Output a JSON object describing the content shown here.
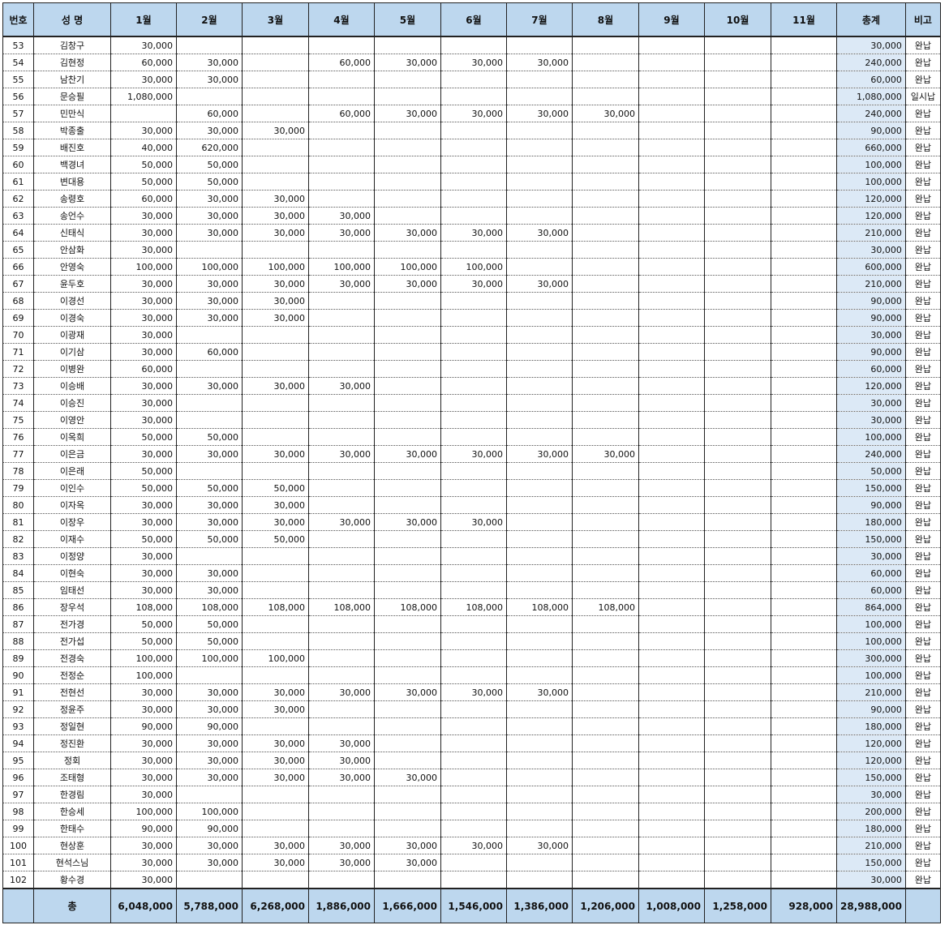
{
  "headers": {
    "no": "번호",
    "name": "성 명",
    "months": [
      "1월",
      "2월",
      "3월",
      "4월",
      "5월",
      "6월",
      "7월",
      "8월",
      "9월",
      "10월",
      "11월"
    ],
    "total": "총계",
    "note": "비고"
  },
  "rows": [
    {
      "no": "53",
      "name": "김창구",
      "m": [
        "30,000",
        "",
        "",
        "",
        "",
        "",
        "",
        "",
        "",
        "",
        ""
      ],
      "total": "30,000",
      "note": "완납"
    },
    {
      "no": "54",
      "name": "김현정",
      "m": [
        "60,000",
        "30,000",
        "",
        "60,000",
        "30,000",
        "30,000",
        "30,000",
        "",
        "",
        "",
        ""
      ],
      "total": "240,000",
      "note": "완납"
    },
    {
      "no": "55",
      "name": "남찬기",
      "m": [
        "30,000",
        "30,000",
        "",
        "",
        "",
        "",
        "",
        "",
        "",
        "",
        ""
      ],
      "total": "60,000",
      "note": "완납"
    },
    {
      "no": "56",
      "name": "문승필",
      "m": [
        "1,080,000",
        "",
        "",
        "",
        "",
        "",
        "",
        "",
        "",
        "",
        ""
      ],
      "total": "1,080,000",
      "note": "일시납"
    },
    {
      "no": "57",
      "name": "민만식",
      "m": [
        "",
        "60,000",
        "",
        "60,000",
        "30,000",
        "30,000",
        "30,000",
        "30,000",
        "",
        "",
        ""
      ],
      "total": "240,000",
      "note": "완납"
    },
    {
      "no": "58",
      "name": "박종출",
      "m": [
        "30,000",
        "30,000",
        "30,000",
        "",
        "",
        "",
        "",
        "",
        "",
        "",
        ""
      ],
      "total": "90,000",
      "note": "완납"
    },
    {
      "no": "59",
      "name": "배진호",
      "m": [
        "40,000",
        "620,000",
        "",
        "",
        "",
        "",
        "",
        "",
        "",
        "",
        ""
      ],
      "total": "660,000",
      "note": "완납"
    },
    {
      "no": "60",
      "name": "백경녀",
      "m": [
        "50,000",
        "50,000",
        "",
        "",
        "",
        "",
        "",
        "",
        "",
        "",
        ""
      ],
      "total": "100,000",
      "note": "완납"
    },
    {
      "no": "61",
      "name": "변대용",
      "m": [
        "50,000",
        "50,000",
        "",
        "",
        "",
        "",
        "",
        "",
        "",
        "",
        ""
      ],
      "total": "100,000",
      "note": "완납"
    },
    {
      "no": "62",
      "name": "송령호",
      "m": [
        "60,000",
        "30,000",
        "30,000",
        "",
        "",
        "",
        "",
        "",
        "",
        "",
        ""
      ],
      "total": "120,000",
      "note": "완납"
    },
    {
      "no": "63",
      "name": "송언수",
      "m": [
        "30,000",
        "30,000",
        "30,000",
        "30,000",
        "",
        "",
        "",
        "",
        "",
        "",
        ""
      ],
      "total": "120,000",
      "note": "완납"
    },
    {
      "no": "64",
      "name": "신태식",
      "m": [
        "30,000",
        "30,000",
        "30,000",
        "30,000",
        "30,000",
        "30,000",
        "30,000",
        "",
        "",
        "",
        ""
      ],
      "total": "210,000",
      "note": "완납"
    },
    {
      "no": "65",
      "name": "안삼화",
      "m": [
        "30,000",
        "",
        "",
        "",
        "",
        "",
        "",
        "",
        "",
        "",
        ""
      ],
      "total": "30,000",
      "note": "완납"
    },
    {
      "no": "66",
      "name": "안영숙",
      "m": [
        "100,000",
        "100,000",
        "100,000",
        "100,000",
        "100,000",
        "100,000",
        "",
        "",
        "",
        "",
        ""
      ],
      "total": "600,000",
      "note": "완납"
    },
    {
      "no": "67",
      "name": "윤두호",
      "m": [
        "30,000",
        "30,000",
        "30,000",
        "30,000",
        "30,000",
        "30,000",
        "30,000",
        "",
        "",
        "",
        ""
      ],
      "total": "210,000",
      "note": "완납"
    },
    {
      "no": "68",
      "name": "이경선",
      "m": [
        "30,000",
        "30,000",
        "30,000",
        "",
        "",
        "",
        "",
        "",
        "",
        "",
        ""
      ],
      "total": "90,000",
      "note": "완납"
    },
    {
      "no": "69",
      "name": "이경숙",
      "m": [
        "30,000",
        "30,000",
        "30,000",
        "",
        "",
        "",
        "",
        "",
        "",
        "",
        ""
      ],
      "total": "90,000",
      "note": "완납"
    },
    {
      "no": "70",
      "name": "이광재",
      "m": [
        "30,000",
        "",
        "",
        "",
        "",
        "",
        "",
        "",
        "",
        "",
        ""
      ],
      "total": "30,000",
      "note": "완납"
    },
    {
      "no": "71",
      "name": "이기삼",
      "m": [
        "30,000",
        "60,000",
        "",
        "",
        "",
        "",
        "",
        "",
        "",
        "",
        ""
      ],
      "total": "90,000",
      "note": "완납"
    },
    {
      "no": "72",
      "name": "이병완",
      "m": [
        "60,000",
        "",
        "",
        "",
        "",
        "",
        "",
        "",
        "",
        "",
        ""
      ],
      "total": "60,000",
      "note": "완납"
    },
    {
      "no": "73",
      "name": "이승배",
      "m": [
        "30,000",
        "30,000",
        "30,000",
        "30,000",
        "",
        "",
        "",
        "",
        "",
        "",
        ""
      ],
      "total": "120,000",
      "note": "완납"
    },
    {
      "no": "74",
      "name": "이승진",
      "m": [
        "30,000",
        "",
        "",
        "",
        "",
        "",
        "",
        "",
        "",
        "",
        ""
      ],
      "total": "30,000",
      "note": "완납"
    },
    {
      "no": "75",
      "name": "이영안",
      "m": [
        "30,000",
        "",
        "",
        "",
        "",
        "",
        "",
        "",
        "",
        "",
        ""
      ],
      "total": "30,000",
      "note": "완납"
    },
    {
      "no": "76",
      "name": "이옥희",
      "m": [
        "50,000",
        "50,000",
        "",
        "",
        "",
        "",
        "",
        "",
        "",
        "",
        ""
      ],
      "total": "100,000",
      "note": "완납"
    },
    {
      "no": "77",
      "name": "이은금",
      "m": [
        "30,000",
        "30,000",
        "30,000",
        "30,000",
        "30,000",
        "30,000",
        "30,000",
        "30,000",
        "",
        "",
        ""
      ],
      "total": "240,000",
      "note": "완납"
    },
    {
      "no": "78",
      "name": "이은래",
      "m": [
        "50,000",
        "",
        "",
        "",
        "",
        "",
        "",
        "",
        "",
        "",
        ""
      ],
      "total": "50,000",
      "note": "완납"
    },
    {
      "no": "79",
      "name": "이인수",
      "m": [
        "50,000",
        "50,000",
        "50,000",
        "",
        "",
        "",
        "",
        "",
        "",
        "",
        ""
      ],
      "total": "150,000",
      "note": "완납"
    },
    {
      "no": "80",
      "name": "이자옥",
      "m": [
        "30,000",
        "30,000",
        "30,000",
        "",
        "",
        "",
        "",
        "",
        "",
        "",
        ""
      ],
      "total": "90,000",
      "note": "완납"
    },
    {
      "no": "81",
      "name": "이장우",
      "m": [
        "30,000",
        "30,000",
        "30,000",
        "30,000",
        "30,000",
        "30,000",
        "",
        "",
        "",
        "",
        ""
      ],
      "total": "180,000",
      "note": "완납"
    },
    {
      "no": "82",
      "name": "이재수",
      "m": [
        "50,000",
        "50,000",
        "50,000",
        "",
        "",
        "",
        "",
        "",
        "",
        "",
        ""
      ],
      "total": "150,000",
      "note": "완납"
    },
    {
      "no": "83",
      "name": "이정양",
      "m": [
        "30,000",
        "",
        "",
        "",
        "",
        "",
        "",
        "",
        "",
        "",
        ""
      ],
      "total": "30,000",
      "note": "완납"
    },
    {
      "no": "84",
      "name": "이현숙",
      "m": [
        "30,000",
        "30,000",
        "",
        "",
        "",
        "",
        "",
        "",
        "",
        "",
        ""
      ],
      "total": "60,000",
      "note": "완납"
    },
    {
      "no": "85",
      "name": "임태선",
      "m": [
        "30,000",
        "30,000",
        "",
        "",
        "",
        "",
        "",
        "",
        "",
        "",
        ""
      ],
      "total": "60,000",
      "note": "완납"
    },
    {
      "no": "86",
      "name": "장우석",
      "m": [
        "108,000",
        "108,000",
        "108,000",
        "108,000",
        "108,000",
        "108,000",
        "108,000",
        "108,000",
        "",
        "",
        ""
      ],
      "total": "864,000",
      "note": "완납"
    },
    {
      "no": "87",
      "name": "전가경",
      "m": [
        "50,000",
        "50,000",
        "",
        "",
        "",
        "",
        "",
        "",
        "",
        "",
        ""
      ],
      "total": "100,000",
      "note": "완납"
    },
    {
      "no": "88",
      "name": "전가섭",
      "m": [
        "50,000",
        "50,000",
        "",
        "",
        "",
        "",
        "",
        "",
        "",
        "",
        ""
      ],
      "total": "100,000",
      "note": "완납"
    },
    {
      "no": "89",
      "name": "전경숙",
      "m": [
        "100,000",
        "100,000",
        "100,000",
        "",
        "",
        "",
        "",
        "",
        "",
        "",
        ""
      ],
      "total": "300,000",
      "note": "완납"
    },
    {
      "no": "90",
      "name": "전정순",
      "m": [
        "100,000",
        "",
        "",
        "",
        "",
        "",
        "",
        "",
        "",
        "",
        ""
      ],
      "total": "100,000",
      "note": "완납"
    },
    {
      "no": "91",
      "name": "전현선",
      "m": [
        "30,000",
        "30,000",
        "30,000",
        "30,000",
        "30,000",
        "30,000",
        "30,000",
        "",
        "",
        "",
        ""
      ],
      "total": "210,000",
      "note": "완납"
    },
    {
      "no": "92",
      "name": "정윤주",
      "m": [
        "30,000",
        "30,000",
        "30,000",
        "",
        "",
        "",
        "",
        "",
        "",
        "",
        ""
      ],
      "total": "90,000",
      "note": "완납"
    },
    {
      "no": "93",
      "name": "정일현",
      "m": [
        "90,000",
        "90,000",
        "",
        "",
        "",
        "",
        "",
        "",
        "",
        "",
        ""
      ],
      "total": "180,000",
      "note": "완납"
    },
    {
      "no": "94",
      "name": "정진환",
      "m": [
        "30,000",
        "30,000",
        "30,000",
        "30,000",
        "",
        "",
        "",
        "",
        "",
        "",
        ""
      ],
      "total": "120,000",
      "note": "완납"
    },
    {
      "no": "95",
      "name": "정회",
      "m": [
        "30,000",
        "30,000",
        "30,000",
        "30,000",
        "",
        "",
        "",
        "",
        "",
        "",
        ""
      ],
      "total": "120,000",
      "note": "완납"
    },
    {
      "no": "96",
      "name": "조태형",
      "m": [
        "30,000",
        "30,000",
        "30,000",
        "30,000",
        "30,000",
        "",
        "",
        "",
        "",
        "",
        ""
      ],
      "total": "150,000",
      "note": "완납"
    },
    {
      "no": "97",
      "name": "한경림",
      "m": [
        "30,000",
        "",
        "",
        "",
        "",
        "",
        "",
        "",
        "",
        "",
        ""
      ],
      "total": "30,000",
      "note": "완납"
    },
    {
      "no": "98",
      "name": "한승세",
      "m": [
        "100,000",
        "100,000",
        "",
        "",
        "",
        "",
        "",
        "",
        "",
        "",
        ""
      ],
      "total": "200,000",
      "note": "완납"
    },
    {
      "no": "99",
      "name": "한태수",
      "m": [
        "90,000",
        "90,000",
        "",
        "",
        "",
        "",
        "",
        "",
        "",
        "",
        ""
      ],
      "total": "180,000",
      "note": "완납"
    },
    {
      "no": "100",
      "name": "현상훈",
      "m": [
        "30,000",
        "30,000",
        "30,000",
        "30,000",
        "30,000",
        "30,000",
        "30,000",
        "",
        "",
        "",
        ""
      ],
      "total": "210,000",
      "note": "완납"
    },
    {
      "no": "101",
      "name": "현석스님",
      "m": [
        "30,000",
        "30,000",
        "30,000",
        "30,000",
        "30,000",
        "",
        "",
        "",
        "",
        "",
        ""
      ],
      "total": "150,000",
      "note": "완납"
    },
    {
      "no": "102",
      "name": "황수경",
      "m": [
        "30,000",
        "",
        "",
        "",
        "",
        "",
        "",
        "",
        "",
        "",
        ""
      ],
      "total": "30,000",
      "note": "완납"
    }
  ],
  "footer": {
    "no": "",
    "label": "총",
    "months": [
      "6,048,000",
      "5,788,000",
      "6,268,000",
      "1,886,000",
      "1,666,000",
      "1,546,000",
      "1,386,000",
      "1,206,000",
      "1,008,000",
      "1,258,000",
      "928,000"
    ],
    "total": "28,988,000",
    "note": ""
  }
}
